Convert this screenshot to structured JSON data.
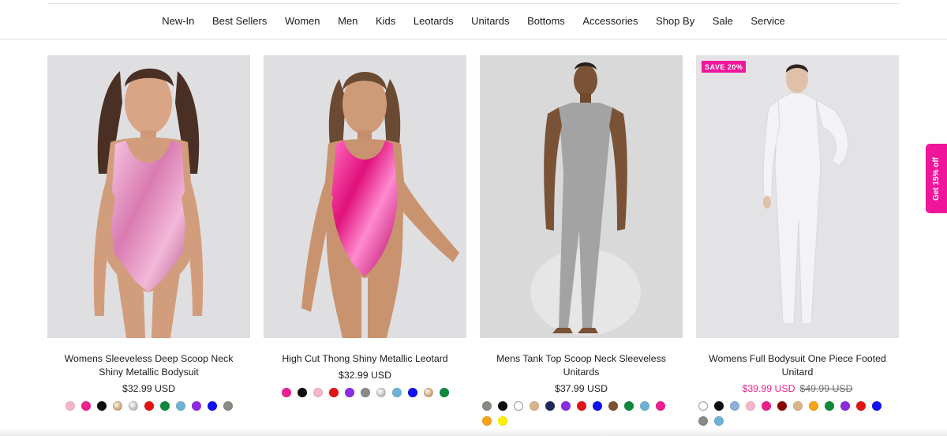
{
  "nav": {
    "items": [
      "New-In",
      "Best Sellers",
      "Women",
      "Men",
      "Kids",
      "Leotards",
      "Unitards",
      "Bottoms",
      "Accessories",
      "Shop By",
      "Sale",
      "Service"
    ]
  },
  "side_tab": {
    "label": "Get 15% off",
    "color": "#f0169b"
  },
  "products": [
    {
      "title": "Womens Sleeveless Deep Scoop Neck Shiny Metallic Bodysuit",
      "price": "$32.99 USD",
      "swatches": [
        "#f6b6c9",
        "#ef1f8f",
        "#0d0d0d",
        "tan-metallic",
        "silver-metallic",
        "#e41414",
        "#0f8a3c",
        "#6fb3d2",
        "#8b2be2",
        "#1010f0",
        "#8a8a85"
      ]
    },
    {
      "title": "High Cut Thong Shiny Metallic Leotard",
      "price": "$32.99 USD",
      "swatches": [
        "#ef1f8f",
        "#0d0d0d",
        "#f6b6c9",
        "#e41414",
        "#8b2be2",
        "#8a8a85",
        "silver-metallic",
        "#6fb3d2",
        "#1010f0",
        "tan-metallic",
        "#0f8a3c"
      ]
    },
    {
      "title": "Mens Tank Top Scoop Neck Sleeveless Unitards",
      "price": "$37.99 USD",
      "swatches": [
        "#8a8a85",
        "#0d0d0d",
        "#ffffff",
        "#d9b488",
        "#1d2b5a",
        "#8b2be2",
        "#e41414",
        "#1010f0",
        "#7a5230",
        "#0f8a3c",
        "#6fb3d2",
        "#ef1f8f",
        "#f7a318",
        "#fff200"
      ]
    },
    {
      "badge": "SAVE 20%",
      "title": "Womens Full Bodysuit One Piece Footed Unitard",
      "sale_price": "$39.99 USD",
      "compare_price": "$49.99 USD",
      "swatches": [
        "#ffffff",
        "#0d0d0d",
        "#8fb0db",
        "#f6b6c9",
        "#ef1f8f",
        "#8b0000",
        "#d9b488",
        "#f7a318",
        "#0f8a3c",
        "#8b2be2",
        "#e41414",
        "#1010f0",
        "#8a8a85",
        "#6fb3d2"
      ]
    }
  ]
}
